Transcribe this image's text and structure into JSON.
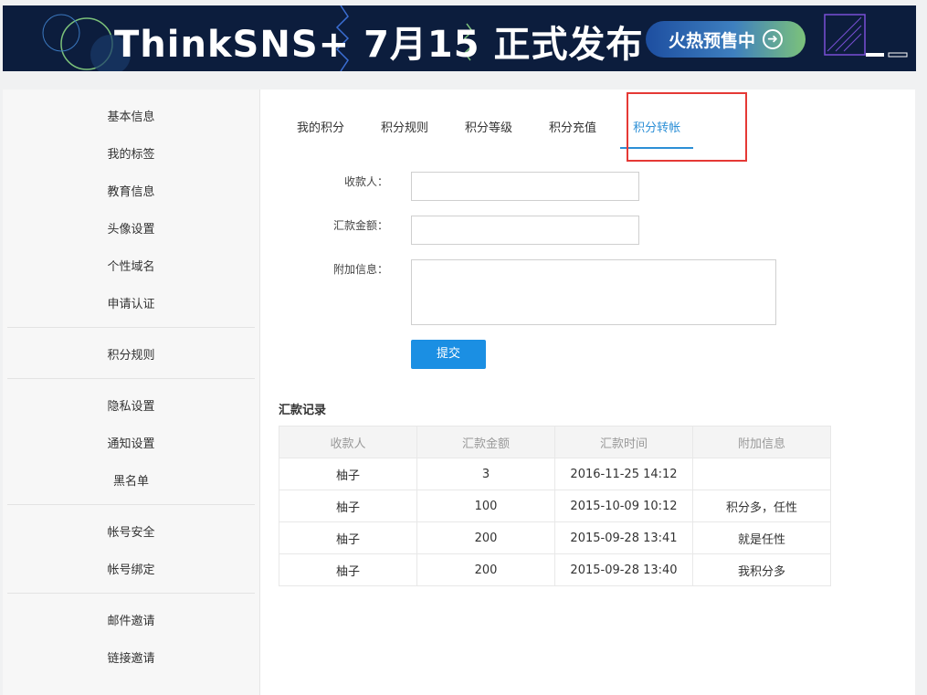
{
  "banner": {
    "title": "ThinkSNS+ 7月15 正式发布",
    "cta": "火热预售中"
  },
  "sidebar": {
    "groups": [
      [
        "基本信息",
        "我的标签",
        "教育信息",
        "头像设置",
        "个性域名",
        "申请认证"
      ],
      [
        "积分规则"
      ],
      [
        "隐私设置",
        "通知设置",
        "黑名单"
      ],
      [
        "帐号安全",
        "帐号绑定"
      ],
      [
        "邮件邀请",
        "链接邀请"
      ]
    ]
  },
  "tabs": [
    "我的积分",
    "积分规则",
    "积分等级",
    "积分充值",
    "积分转帐"
  ],
  "active_tab": 4,
  "form": {
    "recipient_label": "收款人：",
    "amount_label": "汇款金额：",
    "note_label": "附加信息：",
    "recipient_value": "",
    "amount_value": "",
    "note_value": "",
    "submit": "提交"
  },
  "records": {
    "title": "汇款记录",
    "headers": [
      "收款人",
      "汇款金额",
      "汇款时间",
      "附加信息"
    ],
    "rows": [
      [
        "柚子",
        "3",
        "2016-11-25 14:12",
        ""
      ],
      [
        "柚子",
        "100",
        "2015-10-09 10:12",
        "积分多，任性"
      ],
      [
        "柚子",
        "200",
        "2015-09-28 13:41",
        "就是任性"
      ],
      [
        "柚子",
        "200",
        "2015-09-28 13:40",
        "我积分多"
      ]
    ]
  },
  "colors": {
    "accent": "#1b8fe3",
    "banner_bg": "#0c1d3d",
    "highlight": "#e53935"
  }
}
